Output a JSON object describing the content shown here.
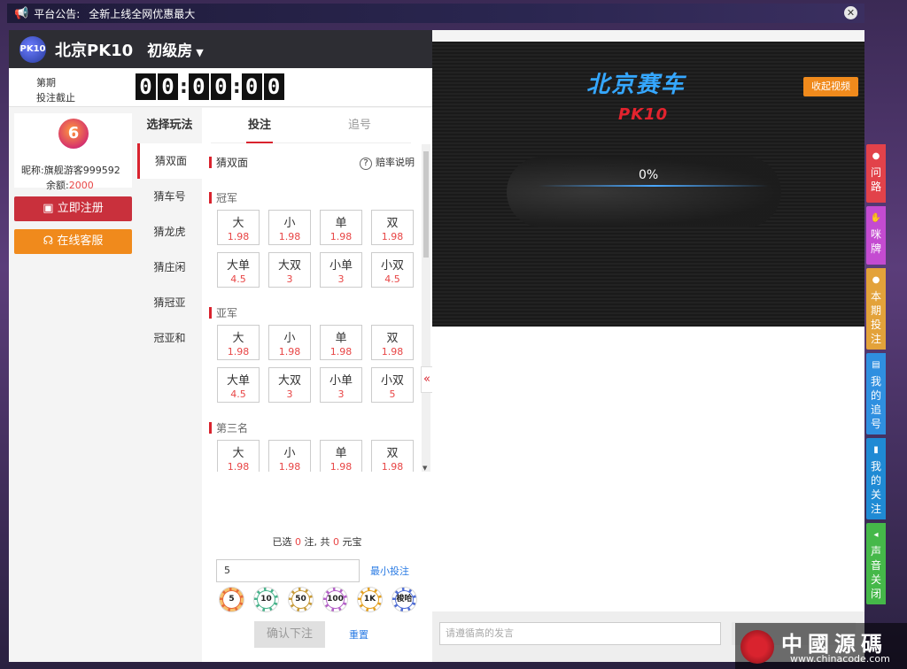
{
  "notice": {
    "label": "平台公告:",
    "text": "全新上线全网优惠最大",
    "close": "✕"
  },
  "header": {
    "logo": "PK10",
    "title": "北京PK10",
    "room": "初级房",
    "room_caret": "▼"
  },
  "period": {
    "line1": "第期",
    "line2": "投注截止",
    "timer": [
      "0",
      "0",
      ":",
      "0",
      "0",
      ":",
      "0",
      "0"
    ]
  },
  "user": {
    "avatar": "6",
    "nick_label": "昵称:",
    "nick": "旗舰游客999592",
    "balance_label": "余额:",
    "balance": "2000",
    "register": "立即注册",
    "service": "在线客服"
  },
  "play": {
    "head": "选择玩法",
    "items": [
      "猜双面",
      "猜车号",
      "猜龙虎",
      "猜庄闲",
      "猜冠亚",
      "冠亚和"
    ]
  },
  "bet": {
    "tabs": [
      "投注",
      "追号"
    ],
    "subhead": "猜双面",
    "rate_help": "?",
    "rate_label": "赔率说明",
    "sections": [
      {
        "title": "冠军",
        "cells": [
          {
            "n": "大",
            "o": "1.98"
          },
          {
            "n": "小",
            "o": "1.98"
          },
          {
            "n": "单",
            "o": "1.98"
          },
          {
            "n": "双",
            "o": "1.98"
          },
          {
            "n": "大单",
            "o": "4.5"
          },
          {
            "n": "大双",
            "o": "3"
          },
          {
            "n": "小单",
            "o": "3"
          },
          {
            "n": "小双",
            "o": "4.5"
          }
        ]
      },
      {
        "title": "亚军",
        "cells": [
          {
            "n": "大",
            "o": "1.98"
          },
          {
            "n": "小",
            "o": "1.98"
          },
          {
            "n": "单",
            "o": "1.98"
          },
          {
            "n": "双",
            "o": "1.98"
          },
          {
            "n": "大单",
            "o": "4.5"
          },
          {
            "n": "大双",
            "o": "3"
          },
          {
            "n": "小单",
            "o": "3"
          },
          {
            "n": "小双",
            "o": "5"
          }
        ]
      },
      {
        "title": "第三名",
        "cells": [
          {
            "n": "大",
            "o": "1.98"
          },
          {
            "n": "小",
            "o": "1.98"
          },
          {
            "n": "单",
            "o": "1.98"
          },
          {
            "n": "双",
            "o": "1.98"
          }
        ]
      }
    ],
    "summary_pre": "已选",
    "summary_count": "0",
    "summary_mid": "注, 共",
    "summary_amount": "0",
    "summary_post": "元宝",
    "amount_value": "5",
    "min_bet": "最小投注",
    "chips": [
      "5",
      "10",
      "50",
      "100",
      "1K",
      "梭哈"
    ],
    "confirm": "确认下注",
    "reset": "重置"
  },
  "collapse_icon": "«",
  "video": {
    "title": "北京赛车",
    "subtitle": "PK10",
    "collapse": "收起视频",
    "progress": "0%"
  },
  "chat": {
    "placeholder": "请遵循高的发言"
  },
  "sidemenu": [
    {
      "icon": "chat-icon",
      "glyph": "●",
      "label": [
        "问",
        "路"
      ]
    },
    {
      "icon": "hand-icon",
      "glyph": "✋",
      "label": [
        "咪",
        "牌"
      ]
    },
    {
      "icon": "plus-icon",
      "glyph": "●",
      "label": [
        "本",
        "期",
        "投",
        "注"
      ]
    },
    {
      "icon": "doc-icon",
      "glyph": "▤",
      "label": [
        "我",
        "的",
        "追",
        "号"
      ]
    },
    {
      "icon": "bookmark-icon",
      "glyph": "▮",
      "label": [
        "我",
        "的",
        "关",
        "注"
      ]
    },
    {
      "icon": "sound-icon",
      "glyph": "◂",
      "label": [
        "声",
        "音",
        "关",
        "闭"
      ]
    }
  ],
  "watermark": {
    "text": "中國源碼",
    "url": "www.chinacode.com"
  }
}
